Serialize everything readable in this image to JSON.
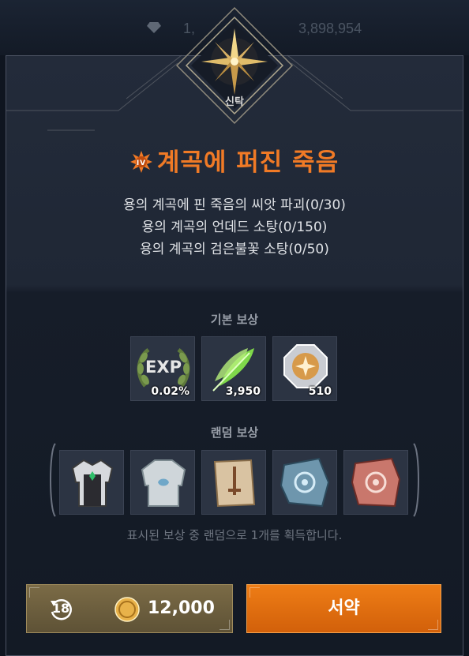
{
  "background": {
    "left_text": "",
    "currency_1": "1,",
    "currency_2": "3,898,954"
  },
  "emblem": {
    "label": "신탁",
    "icon": "compass-star-icon"
  },
  "quest": {
    "title": "계곡에 퍼진 죽음",
    "badge_icon": "orange-sun-badge-icon",
    "objectives": [
      "용의 계곡에 핀 죽음의 씨앗 파괴(0/30)",
      "용의 계곡의 언데드 소탕(0/150)",
      "용의 계곡의 검은불꽃 소탕(0/50)"
    ]
  },
  "basic_rewards": {
    "label": "기본 보상",
    "items": [
      {
        "icon": "exp-laurel-icon",
        "text": "EXP",
        "qty": "0.02%"
      },
      {
        "icon": "green-feather-icon",
        "qty": "3,950"
      },
      {
        "icon": "silver-medal-icon",
        "qty": "510"
      }
    ]
  },
  "random_rewards": {
    "label": "랜덤 보상",
    "items": [
      {
        "icon": "dark-armor-icon"
      },
      {
        "icon": "white-plate-armor-icon"
      },
      {
        "icon": "sword-scroll-icon"
      },
      {
        "icon": "blue-rune-scroll-icon"
      },
      {
        "icon": "red-rune-scroll-icon"
      }
    ],
    "note": "표시된 보상 중 랜덤으로 1개를 획득합니다."
  },
  "footer": {
    "refresh_count": "18",
    "cost": "12,000",
    "pledge_label": "서약"
  },
  "colors": {
    "accent_orange": "#f07a26",
    "button_orange": "#e2700f",
    "card_bg": "#1f2735",
    "gold_button": "#6e603f"
  }
}
